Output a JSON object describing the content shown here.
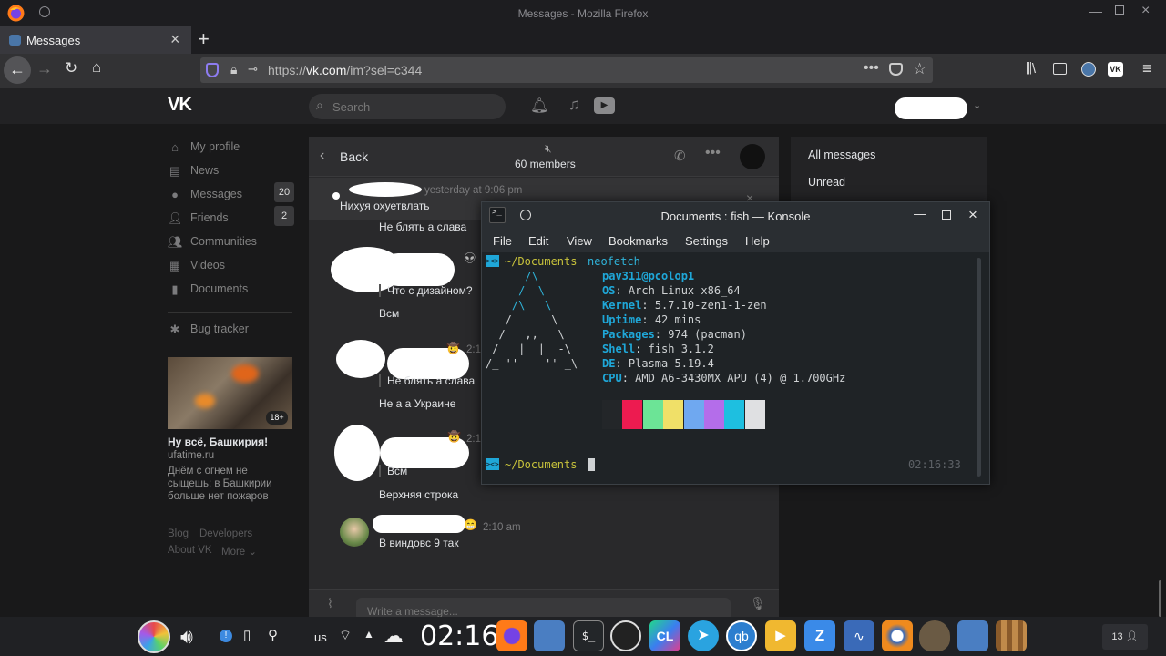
{
  "window_title": "Messages - Mozilla Firefox",
  "tab": {
    "label": "Messages",
    "close": "×",
    "new": "+"
  },
  "url": {
    "protocol": "https://",
    "domain": "vk.com",
    "path": "/im?sel=c344"
  },
  "vk": {
    "search_placeholder": "Search",
    "sidebar": [
      {
        "icon": "home-icon",
        "label": "My profile"
      },
      {
        "icon": "news-icon",
        "label": "News"
      },
      {
        "icon": "messages-icon",
        "label": "Messages",
        "badge": "20"
      },
      {
        "icon": "friends-icon",
        "label": "Friends",
        "badge": "2"
      },
      {
        "icon": "communities-icon",
        "label": "Communities"
      },
      {
        "icon": "videos-icon",
        "label": "Videos"
      },
      {
        "icon": "documents-icon",
        "label": "Documents"
      },
      {
        "icon": "bug-icon",
        "label": "Bug tracker"
      }
    ],
    "ad": {
      "badge": "18+",
      "title": "Ну всё, Башкирия!",
      "domain": "ufatime.ru",
      "text1": "Днём с огнем не",
      "text2": "сыщешь: в Башкирии",
      "text3": "больше нет пожаров"
    },
    "footer": {
      "blog": "Blog",
      "developers": "Developers",
      "about": "About VK",
      "more": "More ⌄"
    },
    "chat": {
      "back": "Back",
      "members": "60 members",
      "pinned": {
        "time": "yesterday at 9:06 pm",
        "text": "Нихуя охуетвлать"
      },
      "messages": [
        {
          "text": "Не блять а слава"
        },
        {
          "quote": "Что с дизайном?",
          "text": "Всм"
        },
        {
          "time": "2:1",
          "quote": "Не блять а слава",
          "text": "Не а а Украине"
        },
        {
          "time": "2:1",
          "quote": "Всм",
          "text": "Верхняя строка"
        },
        {
          "time": "2:10 am",
          "text": "В виндовс 9 так"
        }
      ],
      "input_placeholder": "Write a message..."
    },
    "right": {
      "all": "All messages",
      "unread": "Unread"
    }
  },
  "konsole": {
    "title": "Documents : fish — Konsole",
    "menu": [
      "File",
      "Edit",
      "View",
      "Bookmarks",
      "Settings",
      "Help"
    ],
    "prompt_path": "~/Documents",
    "command": "neofetch",
    "userhost": "pav311@pcolop1",
    "info": [
      {
        "k": "OS",
        "v": "Arch Linux x86_64"
      },
      {
        "k": "Kernel",
        "v": "5.7.10-zen1-1-zen"
      },
      {
        "k": "Uptime",
        "v": "42 mins"
      },
      {
        "k": "Packages",
        "v": "974 (pacman)"
      },
      {
        "k": "Shell",
        "v": "fish 3.1.2"
      },
      {
        "k": "DE",
        "v": "Plasma 5.19.4"
      },
      {
        "k": "CPU",
        "v": "AMD A6-3430MX APU (4) @ 1.700GHz"
      }
    ],
    "palette": [
      "#232629",
      "#ed1b50",
      "#6ce496",
      "#f0e068",
      "#6fa8f0",
      "#b46dea",
      "#1ebfe0",
      "#dfe0e2"
    ],
    "time": "02:16:33",
    "art": [
      "      /\\",
      "     /  \\",
      "    /\\   \\",
      "   /      \\",
      "  /   ,,   \\",
      " /   |  |  -\\",
      "/_-''    ''-_\\"
    ]
  },
  "taskbar": {
    "kb_layout": "us",
    "clock": "02:16",
    "notif_count": "13"
  }
}
